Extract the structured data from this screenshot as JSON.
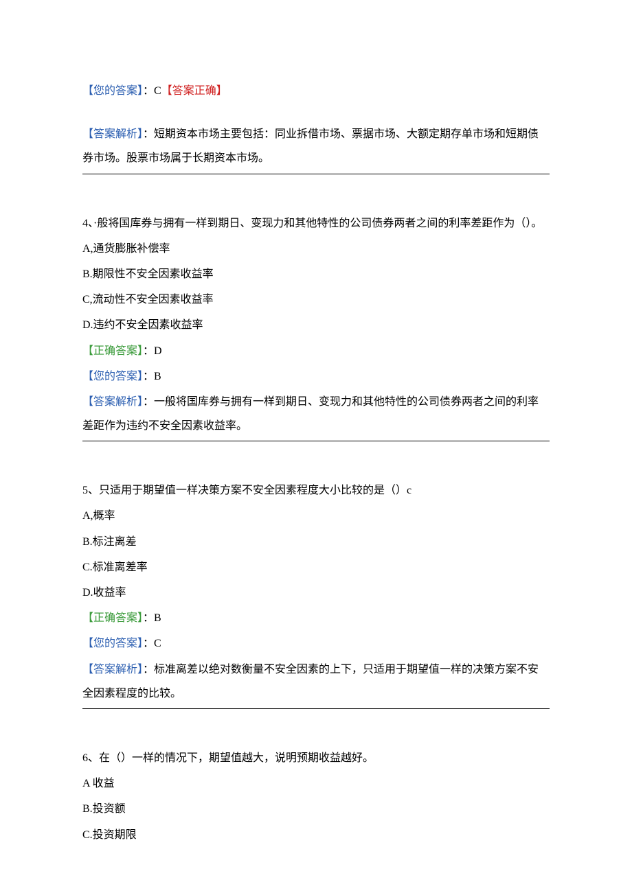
{
  "q3": {
    "your_answer_label": "【您的答案】",
    "your_answer_value": "：C",
    "correct_flag": "【答案正确】",
    "analysis_label": "【答案解析】",
    "analysis_text": "：短期资本市场主要包括：同业拆借市场、票据市场、大额定期存单市场和短期债券市场。股票市场属于长期资本市场。"
  },
  "q4": {
    "stem": "4、·般将国库券与拥有一样到期日、变现力和其他特性的公司债券两者之间的利率差距作为（）。",
    "optA": "A,通货膨胀补偿率",
    "optB": "B.期限性不安全因素收益率",
    "optC": "C,流动性不安全因素收益率",
    "optD": "D.违约不安全因素收益率",
    "correct_label": "【正确答案】",
    "correct_value": "：D",
    "your_answer_label": "【您的答案】",
    "your_answer_value": "：B",
    "analysis_label": "【答案解析】",
    "analysis_text": "：一般将国库券与拥有一样到期日、变现力和其他特性的公司债券两者之间的利率差距作为违约不安全因素收益率。"
  },
  "q5": {
    "stem": "5、只适用于期望值一样决策方案不安全因素程度大小比较的是（）c",
    "optA": "A,概率",
    "optB": "B.标注离差",
    "optC": "C.标准离差率",
    "optD": "D.收益率",
    "correct_label": "【正确答案】",
    "correct_value": "：B",
    "your_answer_label": "【您的答案】",
    "your_answer_value": "：C",
    "analysis_label": "【答案解析】",
    "analysis_text": "：标准离差以绝对数衡量不安全因素的上下，只适用于期望值一样的决策方案不安全因素程度的比较。"
  },
  "q6": {
    "stem": "6、在（）一样的情况下，期望值越大，说明预期收益越好。",
    "optA": "A 收益",
    "optB": "B.投资额",
    "optC": "C.投资期限"
  }
}
